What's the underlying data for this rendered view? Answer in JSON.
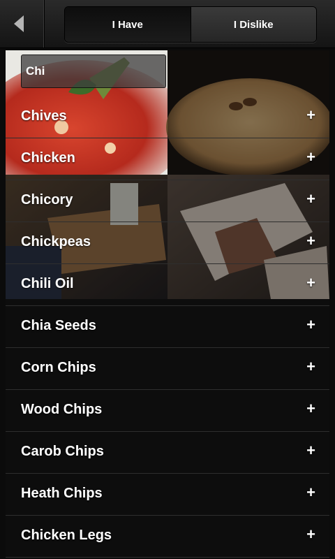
{
  "header": {
    "back_icon": "back-arrow-icon",
    "tabs": [
      {
        "label": "I Have",
        "active": true
      },
      {
        "label": "I Dislike",
        "active": false
      }
    ]
  },
  "search": {
    "value": "Chi"
  },
  "add_icon": "+",
  "results": [
    {
      "label": "Chives"
    },
    {
      "label": "Chicken"
    },
    {
      "label": "Chicory"
    },
    {
      "label": "Chickpeas"
    },
    {
      "label": "Chili Oil"
    },
    {
      "label": "Chia Seeds"
    },
    {
      "label": "Corn Chips"
    },
    {
      "label": "Wood Chips"
    },
    {
      "label": "Carob Chips"
    },
    {
      "label": "Heath Chips"
    },
    {
      "label": "Chicken Legs"
    }
  ],
  "colors": {
    "background": "#0b0b0b",
    "topbar": "#1e1e1e",
    "text": "#ffffff"
  }
}
